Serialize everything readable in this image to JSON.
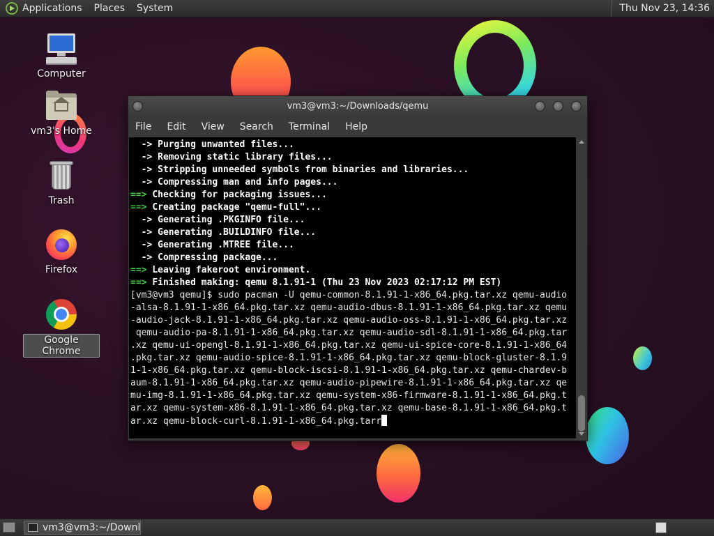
{
  "top_panel": {
    "menus": [
      "Applications",
      "Places",
      "System"
    ],
    "clock": "Thu Nov 23, 14:36"
  },
  "desktop": {
    "icons": [
      {
        "label": "Computer",
        "icon": "computer-icon"
      },
      {
        "label": "vm3's Home",
        "icon": "home-folder-icon"
      },
      {
        "label": "Trash",
        "icon": "trash-icon"
      },
      {
        "label": "Firefox",
        "icon": "firefox-icon"
      },
      {
        "label": "Google Chrome",
        "icon": "chrome-icon",
        "selected": true
      }
    ]
  },
  "terminal": {
    "title": "vm3@vm3:~/Downloads/qemu",
    "menu": [
      "File",
      "Edit",
      "View",
      "Search",
      "Terminal",
      "Help"
    ],
    "lines": [
      {
        "prefix": "  -> ",
        "text": "Purging unwanted files...",
        "style": "arrow"
      },
      {
        "prefix": "  -> ",
        "text": "Removing static library files...",
        "style": "arrow"
      },
      {
        "prefix": "  -> ",
        "text": "Stripping unneeded symbols from binaries and libraries...",
        "style": "arrow"
      },
      {
        "prefix": "  -> ",
        "text": "Compressing man and info pages...",
        "style": "arrow"
      },
      {
        "prefix": "==> ",
        "text": "Checking for packaging issues...",
        "style": "green"
      },
      {
        "prefix": "==> ",
        "text": "Creating package \"qemu-full\"...",
        "style": "green"
      },
      {
        "prefix": "  -> ",
        "text": "Generating .PKGINFO file...",
        "style": "arrow"
      },
      {
        "prefix": "  -> ",
        "text": "Generating .BUILDINFO file...",
        "style": "arrow"
      },
      {
        "prefix": "  -> ",
        "text": "Generating .MTREE file...",
        "style": "arrow"
      },
      {
        "prefix": "  -> ",
        "text": "Compressing package...",
        "style": "arrow"
      },
      {
        "prefix": "==> ",
        "text": "Leaving fakeroot environment.",
        "style": "green"
      },
      {
        "prefix": "==> ",
        "text": "Finished making: qemu 8.1.91-1 (Thu 23 Nov 2023 02:17:12 PM EST)",
        "style": "green"
      },
      {
        "prefix": "",
        "text": "[vm3@vm3 qemu]$ sudo pacman -U qemu-common-8.1.91-1-x86_64.pkg.tar.xz qemu-audio",
        "style": "plain"
      },
      {
        "prefix": "",
        "text": "-alsa-8.1.91-1-x86_64.pkg.tar.xz qemu-audio-dbus-8.1.91-1-x86_64.pkg.tar.xz qemu",
        "style": "plain"
      },
      {
        "prefix": "",
        "text": "-audio-jack-8.1.91-1-x86_64.pkg.tar.xz qemu-audio-oss-8.1.91-1-x86_64.pkg.tar.xz",
        "style": "plain"
      },
      {
        "prefix": "",
        "text": " qemu-audio-pa-8.1.91-1-x86_64.pkg.tar.xz qemu-audio-sdl-8.1.91-1-x86_64.pkg.tar",
        "style": "plain"
      },
      {
        "prefix": "",
        "text": ".xz qemu-ui-opengl-8.1.91-1-x86_64.pkg.tar.xz qemu-ui-spice-core-8.1.91-1-x86_64",
        "style": "plain"
      },
      {
        "prefix": "",
        "text": ".pkg.tar.xz qemu-audio-spice-8.1.91-1-x86_64.pkg.tar.xz qemu-block-gluster-8.1.9",
        "style": "plain"
      },
      {
        "prefix": "",
        "text": "1-1-x86_64.pkg.tar.xz qemu-block-iscsi-8.1.91-1-x86_64.pkg.tar.xz qemu-chardev-b",
        "style": "plain"
      },
      {
        "prefix": "",
        "text": "aum-8.1.91-1-x86_64.pkg.tar.xz qemu-audio-pipewire-8.1.91-1-x86_64.pkg.tar.xz qe",
        "style": "plain"
      },
      {
        "prefix": "",
        "text": "mu-img-8.1.91-1-x86_64.pkg.tar.xz qemu-system-x86-firmware-8.1.91-1-x86_64.pkg.t",
        "style": "plain"
      },
      {
        "prefix": "",
        "text": "ar.xz qemu-system-x86-8.1.91-1-x86_64.pkg.tar.xz qemu-base-8.1.91-1-x86_64.pkg.t",
        "style": "plain"
      },
      {
        "prefix": "",
        "text": "ar.xz qemu-block-curl-8.1.91-1-x86_64.pkg.tarr",
        "style": "plain",
        "cursor": true
      }
    ]
  },
  "bottom_panel": {
    "task_label": "vm3@vm3:~/Downl..."
  }
}
